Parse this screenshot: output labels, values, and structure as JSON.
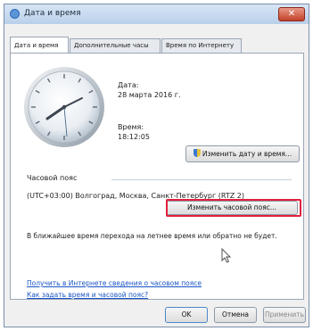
{
  "window": {
    "title": "Дата и время",
    "close_label": "✕"
  },
  "tabs": [
    {
      "label": "Дата и время"
    },
    {
      "label": "Дополнительные часы"
    },
    {
      "label": "Время по Интернету"
    }
  ],
  "date_time": {
    "date_label": "Дата:",
    "date_value": "28 марта 2016 г.",
    "time_label": "Время:",
    "time_value": "18:12:05",
    "change_datetime_button": "Изменить дату и время..."
  },
  "timezone": {
    "section_label": "Часовой пояс",
    "value": "(UTC+03:00) Волгоград, Москва, Санкт-Петербург (RTZ 2)",
    "change_button": "Изменить часовой пояс..."
  },
  "dst_notice": "В ближайшее время перехода на летнее время или обратно не будет.",
  "links": {
    "online_info": "Получить в Интернете сведения о часовом поясе",
    "how_to_set": "Как задать время и часовой пояс?"
  },
  "buttons": {
    "ok": "OK",
    "cancel": "Отмена",
    "apply": "Применить"
  },
  "colors": {
    "highlight": "#e0203a",
    "link": "#1a55c4"
  },
  "icons": {
    "app": "clock-icon",
    "uac": "shield-icon",
    "close": "close-icon",
    "cursor": "mouse-pointer-icon"
  }
}
